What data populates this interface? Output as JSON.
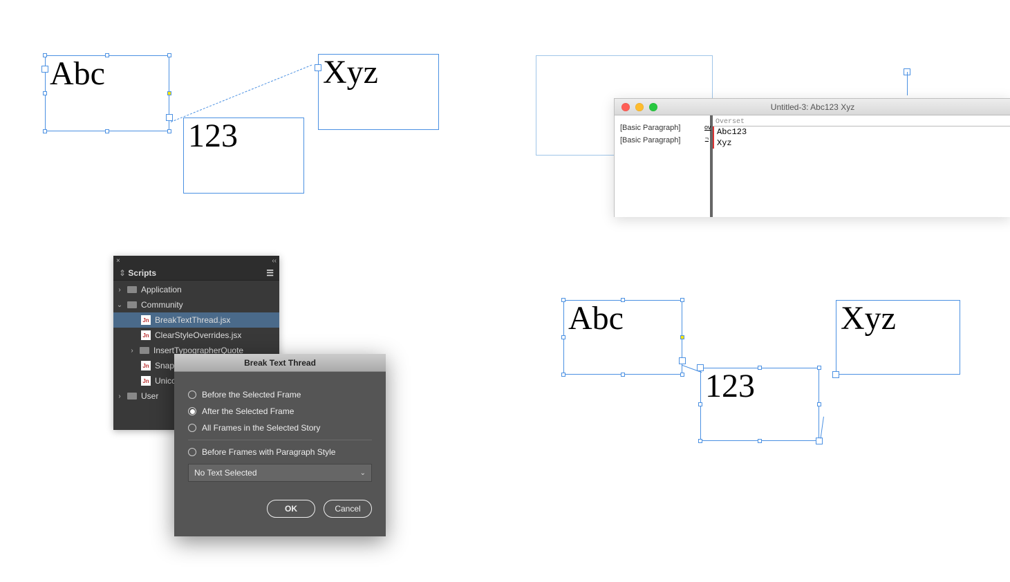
{
  "tl_frames": {
    "a": "Abc",
    "b": "123",
    "c": "Xyz"
  },
  "story_editor": {
    "window_title": "Untitled-3: Abc123 Xyz",
    "rows": [
      {
        "style": "[Basic Paragraph]",
        "badge": "ov",
        "text": "Abc123"
      },
      {
        "style": "[Basic Paragraph]",
        "badge": "¬",
        "text": "Xyz"
      }
    ],
    "overset_label": "Overset"
  },
  "scripts_panel": {
    "title": "Scripts",
    "folders": {
      "application": "Application",
      "community": "Community",
      "user": "User"
    },
    "scripts": [
      "BreakTextThread.jsx",
      "ClearStyleOverrides.jsx",
      "InsertTypographerQuote",
      "Snap",
      "Unico"
    ]
  },
  "dialog": {
    "title": "Break Text Thread",
    "options": [
      "Before the Selected Frame",
      "After the Selected Frame",
      "All Frames in the Selected Story",
      "Before Frames with Paragraph Style"
    ],
    "selected_index": 1,
    "dropdown_value": "No Text Selected",
    "ok": "OK",
    "cancel": "Cancel"
  },
  "br_frames": {
    "a": "Abc",
    "b": "123",
    "c": "Xyz"
  }
}
